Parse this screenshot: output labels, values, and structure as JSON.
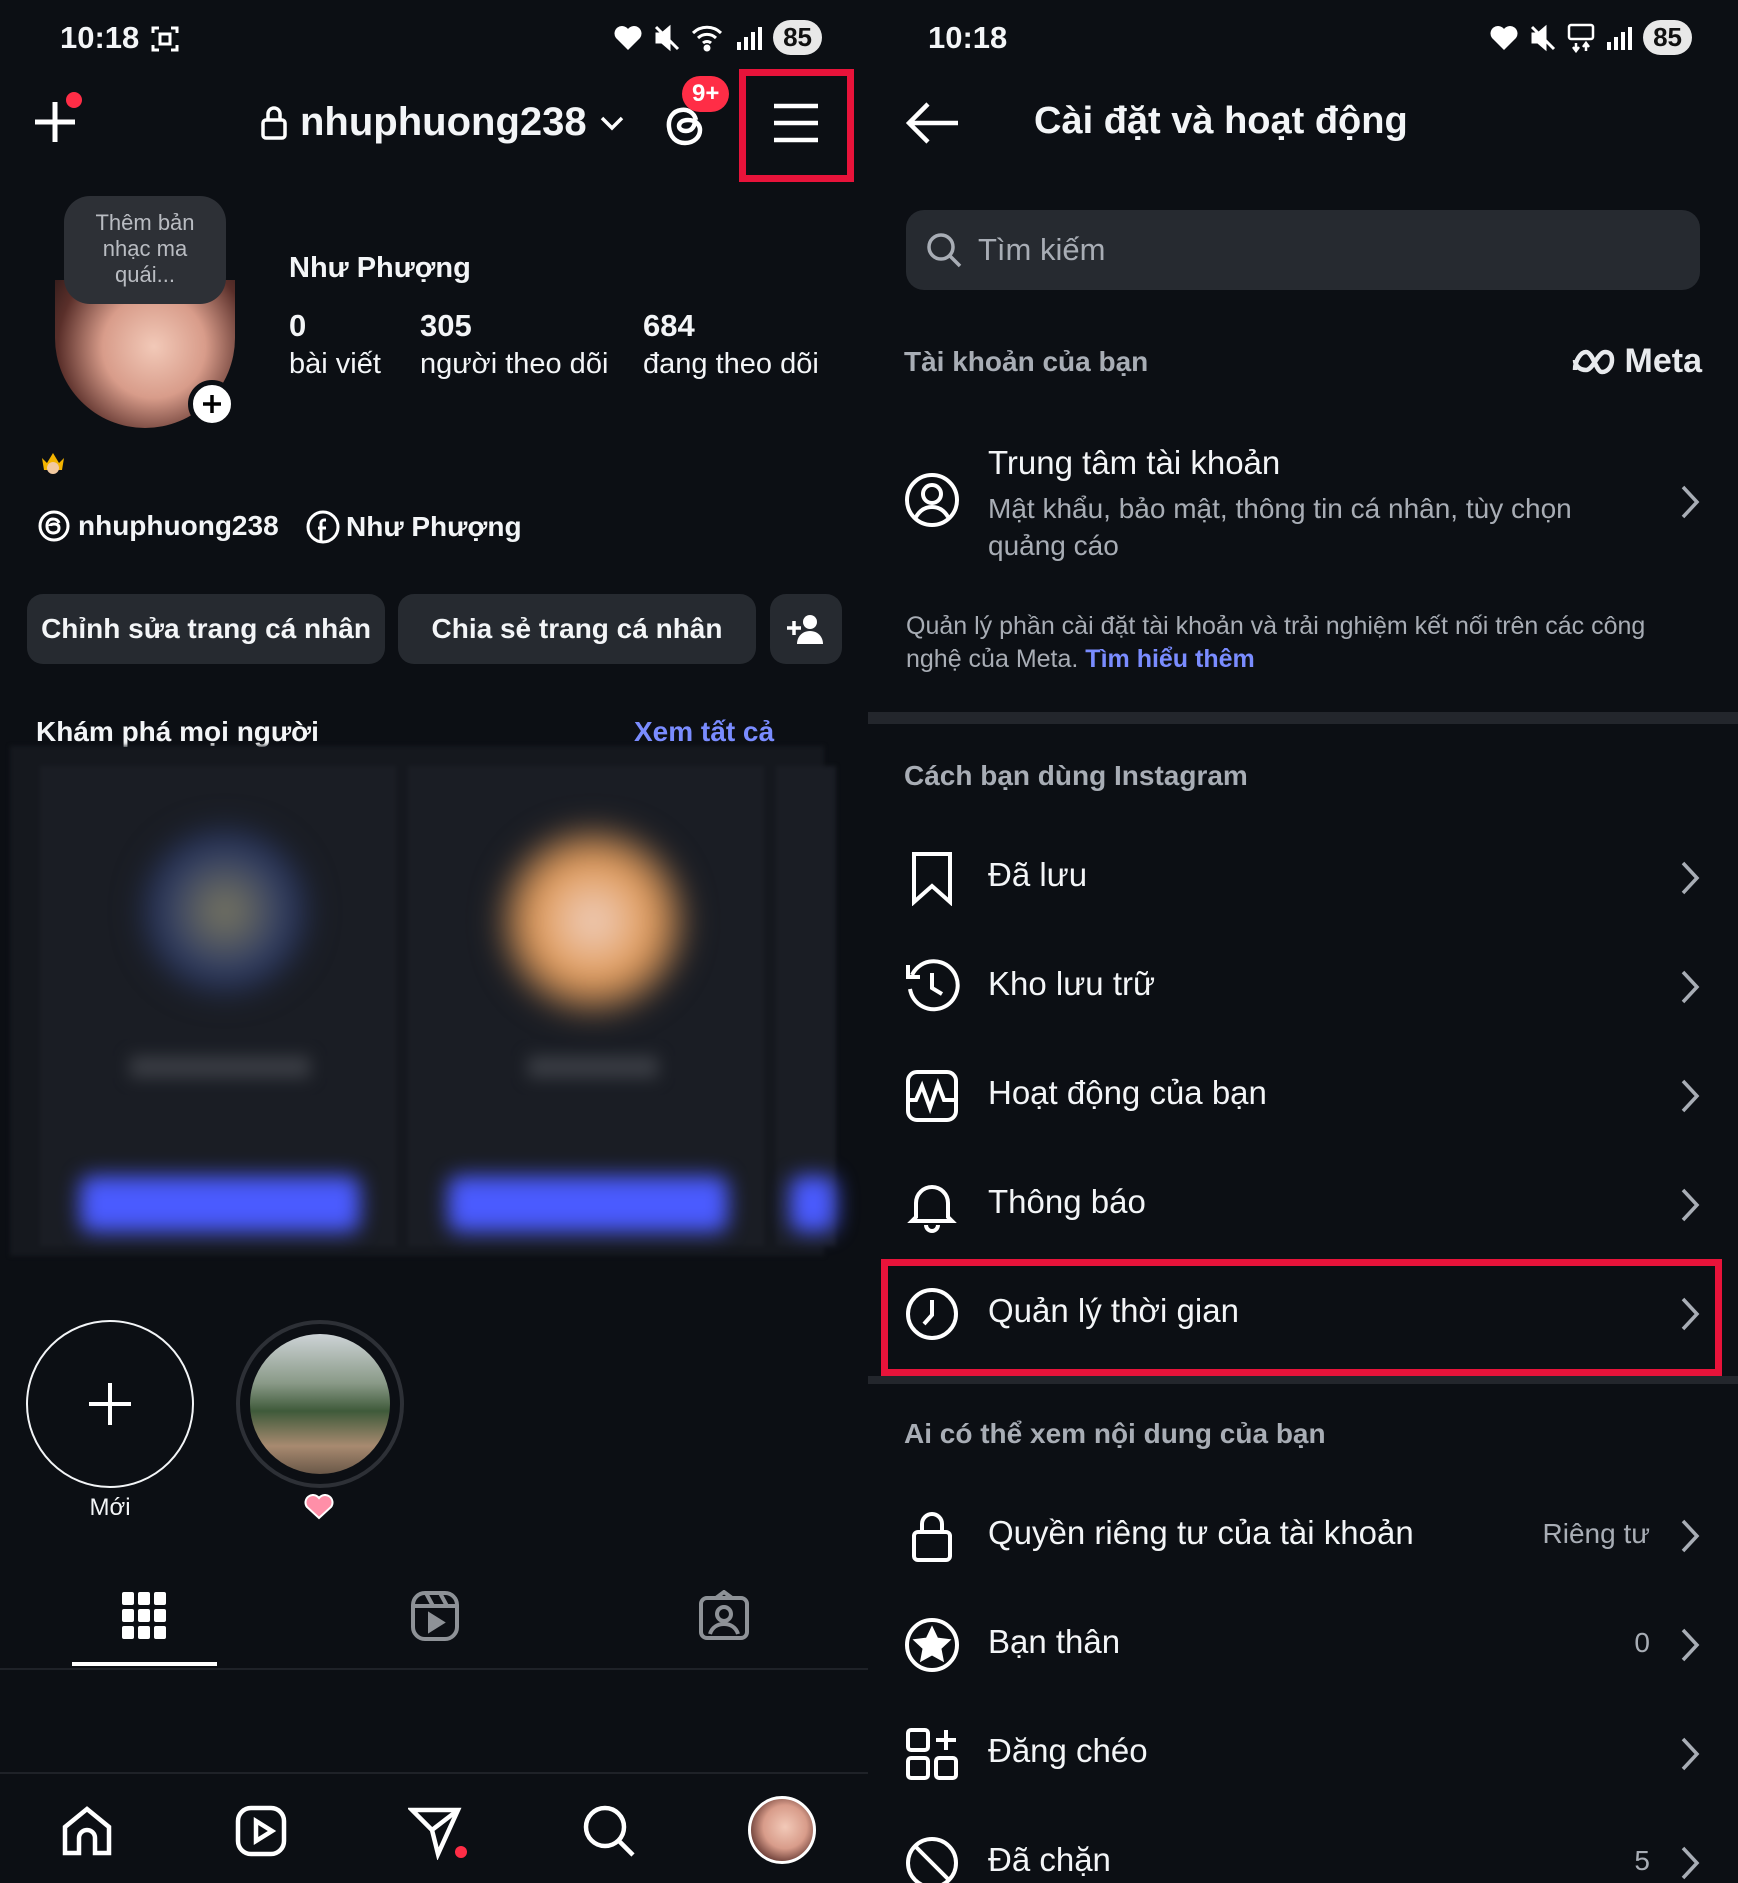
{
  "left": {
    "status": {
      "time": "10:18",
      "battery": "85"
    },
    "header": {
      "username": "nhuphuong238",
      "threads_badge": "9+"
    },
    "profile": {
      "note": "Thêm bản nhạc ma quái...",
      "display_name": "Như Phượng",
      "stats": [
        {
          "value": "0",
          "label": "bài viết"
        },
        {
          "value": "305",
          "label": "người theo dõi"
        },
        {
          "value": "684",
          "label": "đang theo dõi"
        }
      ],
      "threads_handle": "nhuphuong238",
      "facebook_name": "Như Phượng"
    },
    "actions": {
      "edit": "Chỉnh sửa trang cá nhân",
      "share": "Chia sẻ trang cá nhân"
    },
    "discover": {
      "title": "Khám phá mọi người",
      "see_all": "Xem tất cả"
    },
    "highlights": {
      "new_label": "Mới"
    }
  },
  "right": {
    "status": {
      "time": "10:18",
      "battery": "85"
    },
    "title": "Cài đặt và hoạt động",
    "search_placeholder": "Tìm kiếm",
    "account_section": "Tài khoản của bạn",
    "meta_label": "Meta",
    "account_center": {
      "title": "Trung tâm tài khoản",
      "subtitle": "Mật khẩu, bảo mật, thông tin cá nhân, tùy chọn quảng cáo"
    },
    "meta_note": "Quản lý phần cài đặt tài khoản và trải nghiệm kết nối trên các công nghệ của Meta.",
    "learn_more": "Tìm hiểu thêm",
    "usage_section": "Cách bạn dùng Instagram",
    "usage_items": [
      {
        "label": "Đã lưu",
        "icon": "bookmark-icon"
      },
      {
        "label": "Kho lưu trữ",
        "icon": "archive-icon"
      },
      {
        "label": "Hoạt động của bạn",
        "icon": "activity-icon"
      },
      {
        "label": "Thông báo",
        "icon": "bell-icon"
      },
      {
        "label": "Quản lý thời gian",
        "icon": "clock-icon"
      }
    ],
    "visibility_section": "Ai có thể xem nội dung của bạn",
    "visibility_items": [
      {
        "label": "Quyền riêng tư của tài khoản",
        "value": "Riêng tư",
        "icon": "lock-icon"
      },
      {
        "label": "Bạn thân",
        "value": "0",
        "icon": "star-icon"
      },
      {
        "label": "Đăng chéo",
        "value": "",
        "icon": "crosspost-icon"
      },
      {
        "label": "Đã chặn",
        "value": "5",
        "icon": "blocked-icon"
      }
    ]
  },
  "colors": {
    "highlight": "#e8133a",
    "link": "#7a8cff",
    "background": "#0c0f14"
  }
}
